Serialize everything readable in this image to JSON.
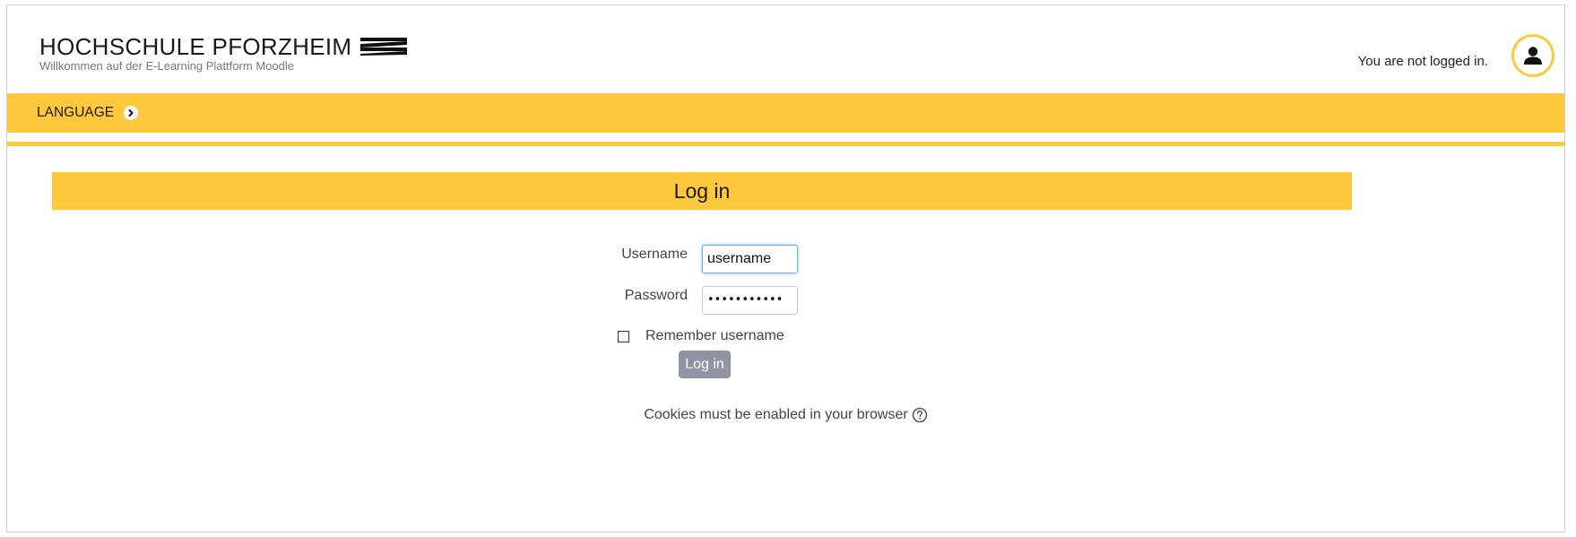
{
  "header": {
    "site_title": "HOCHSCHULE PFORZHEIM",
    "site_subtitle": "Willkommen auf der E-Learning Plattform Moodle",
    "login_status": "You are not logged in.",
    "logo_icon": "hs-pforzheim-logo",
    "user_icon": "user-avatar-icon"
  },
  "navbar": {
    "language_label": "LANGUAGE",
    "language_icon": "chevron-right-circle-icon"
  },
  "login": {
    "heading": "Log in",
    "username_label": "Username",
    "username_value": "username",
    "password_label": "Password",
    "password_value": "•••••••••••",
    "remember_label": "Remember username",
    "remember_checked": false,
    "submit_label": "Log in",
    "cookies_notice": "Cookies must be enabled in your browser",
    "help_icon": "question-circle-icon"
  },
  "colors": {
    "accent_yellow": "#ffc83d",
    "button_gray": "#8f93a3",
    "focus_blue": "#66afe9"
  }
}
